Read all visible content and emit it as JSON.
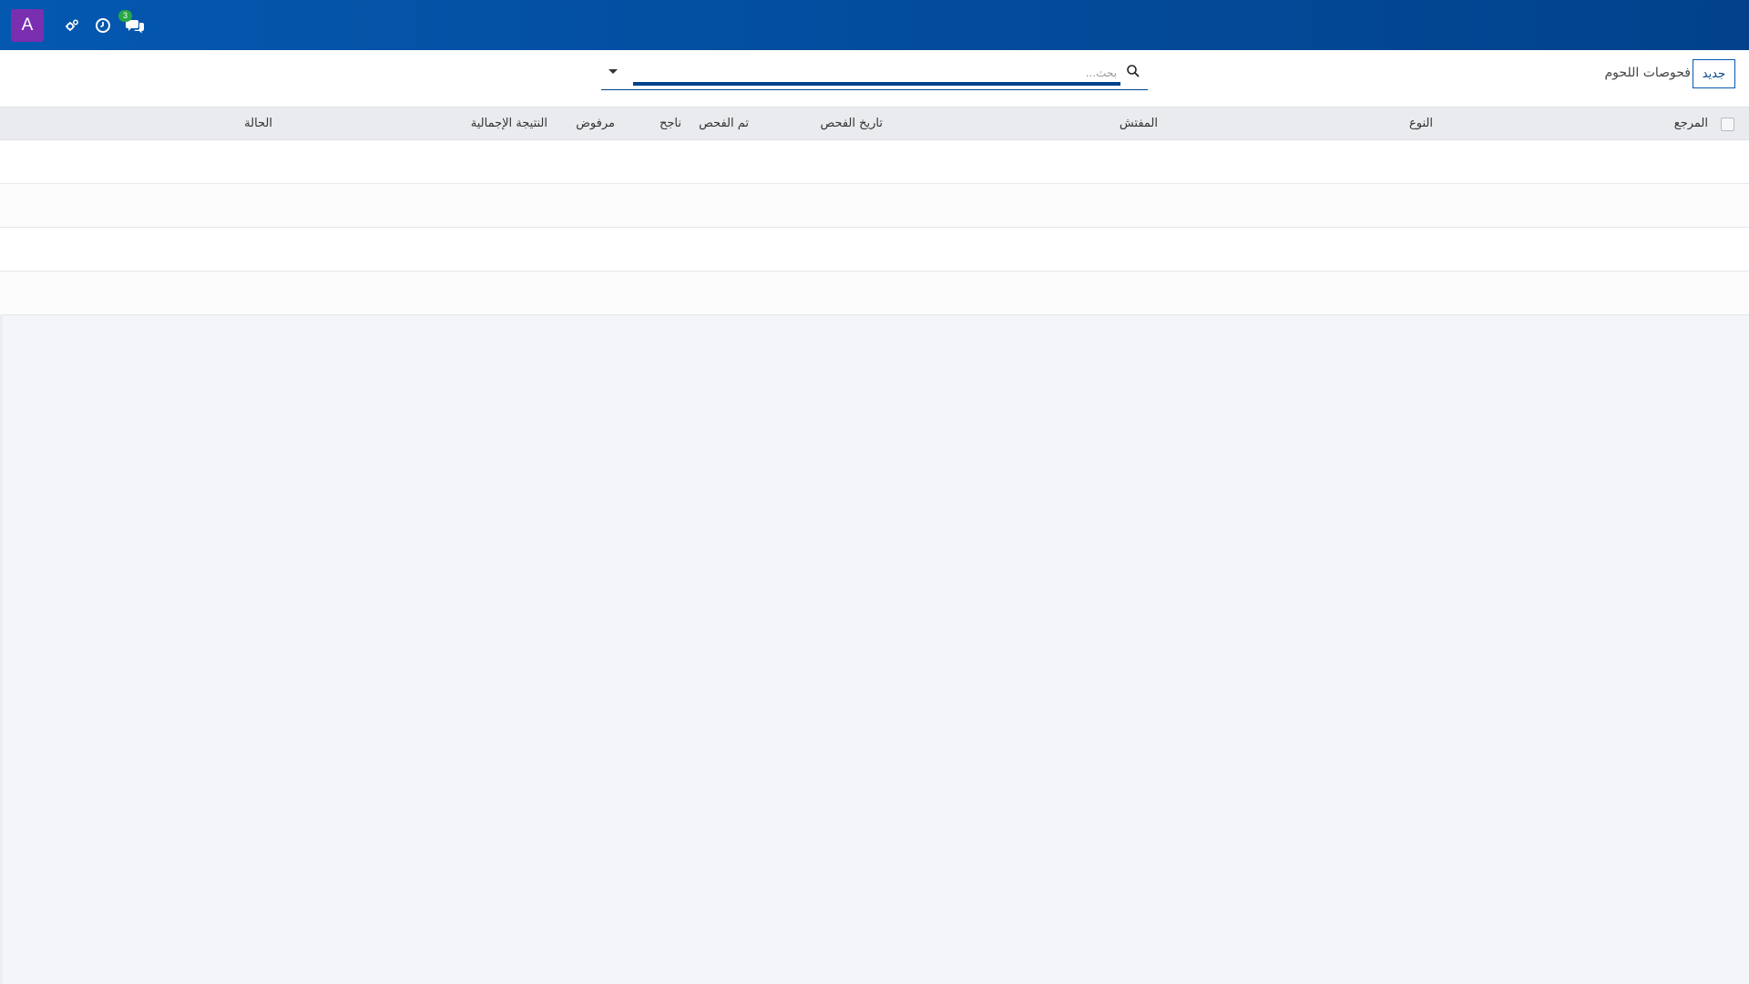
{
  "navbar": {
    "avatar_letter": "A",
    "icons": [
      "settings-icon",
      "clock-icon",
      "chat-icon"
    ],
    "chat_badge": "3"
  },
  "control_panel": {
    "breadcrumb": "فحوصات اللحوم",
    "new_button": "جديد",
    "search": {
      "placeholder": "بحث...",
      "value": ""
    }
  },
  "table": {
    "columns": [
      "المرجع",
      "النوع",
      "المفتش",
      "تاريخ الفحص",
      "تم الفحص",
      "ناجح",
      "مرفوض",
      "النتيجة الإجمالية",
      "الحالة"
    ],
    "rows": [
      [],
      [],
      [],
      []
    ]
  }
}
